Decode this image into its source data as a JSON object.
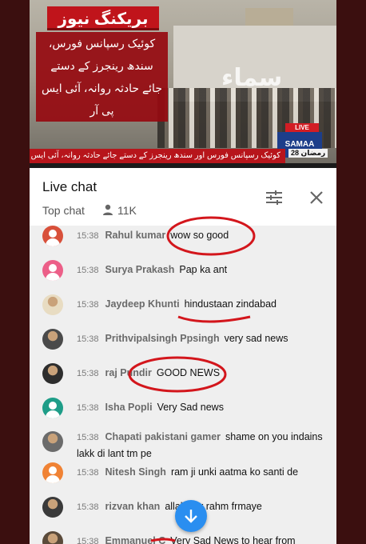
{
  "video": {
    "breaking_label": "بریکنگ نیوز",
    "headline": "کوئیک رسپانس فورس، سندھ رینجرز کے دستے جائے حادثہ روانہ، آئی ایس پی آر",
    "ticker": "کوئیک رسپانس فورس اور سندھ رینجرز کے دستے جائے حادثہ روانہ، آئی ایس پی آر",
    "live_label": "LIVE",
    "channel_name": "SAMAA",
    "date": "28 رمضان",
    "building_text": "سماء"
  },
  "chat_header": {
    "title": "Live chat",
    "mode": "Top chat",
    "viewers": "11K"
  },
  "messages": [
    {
      "time": "15:38",
      "author": "Rahul kumar",
      "text": "wow so good",
      "avatar_color": "#d8503a",
      "avatar_style": "generic"
    },
    {
      "time": "15:38",
      "author": "Surya Prakash",
      "text": "Pap ka ant",
      "avatar_color": "#ec5f88",
      "avatar_style": "generic"
    },
    {
      "time": "15:38",
      "author": "Jaydeep Khunti",
      "text": "hindustaan zindabad",
      "avatar_color": "#e8dcc2",
      "avatar_style": "photo"
    },
    {
      "time": "15:38",
      "author": "Prithvipalsingh Ppsingh",
      "text": "very sad news",
      "avatar_color": "#4a4a4a",
      "avatar_style": "photo"
    },
    {
      "time": "15:38",
      "author": "raj Pundir",
      "text": "GOOD NEWS",
      "avatar_color": "#2d2d2d",
      "avatar_style": "photo"
    },
    {
      "time": "15:38",
      "author": "Isha Popli",
      "text": "Very Sad news",
      "avatar_color": "#1e9d88",
      "avatar_style": "generic"
    },
    {
      "time": "15:38",
      "author": "Chapati pakistani gamer",
      "text": "shame on you indains lakk di lant tm pe",
      "avatar_color": "#6b6b6b",
      "avatar_style": "photo"
    },
    {
      "time": "15:38",
      "author": "Nitesh Singh",
      "text": "ram ji unki aatma ko santi de",
      "avatar_color": "#f08234",
      "avatar_style": "generic"
    },
    {
      "time": "15:38",
      "author": "rizvan khan",
      "text": "allah par rahm frmaye",
      "avatar_color": "#3a3a3a",
      "avatar_style": "photo"
    },
    {
      "time": "15:38",
      "author": "Emmanuel C",
      "text": "Very Sad News to hear from",
      "avatar_color": "#5a4a3a",
      "avatar_style": "photo"
    }
  ],
  "icons": {
    "viewers": "person-icon",
    "filter": "sliders-icon",
    "close": "close-icon",
    "scroll": "arrow-down-icon"
  },
  "colors": {
    "annotation_red": "#d3161c",
    "fab_blue": "#2a8ef0"
  }
}
